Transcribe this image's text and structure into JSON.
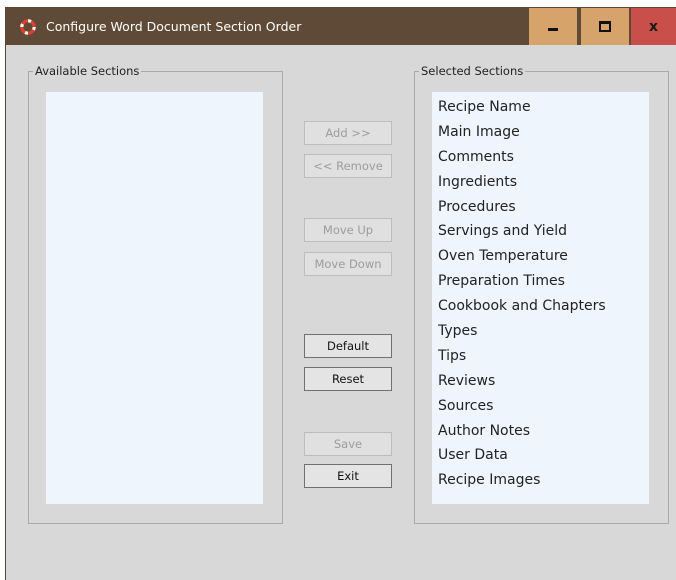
{
  "window": {
    "title": "Configure Word Document Section Order",
    "minimize_icon": "minimize-icon",
    "maximize_icon": "maximize-icon",
    "close_glyph": "x"
  },
  "available": {
    "legend": "Available Sections",
    "items": []
  },
  "selected": {
    "legend": "Selected Sections",
    "items": [
      "Recipe Name",
      "Main Image",
      "Comments",
      "Ingredients",
      "Procedures",
      "Servings and Yield",
      "Oven Temperature",
      "Preparation Times",
      "Cookbook and Chapters",
      "Types",
      "Tips",
      "Reviews",
      "Sources",
      "Author Notes",
      "User Data",
      "Recipe Images"
    ]
  },
  "buttons": {
    "add": "Add >>",
    "remove": "<< Remove",
    "move_up": "Move Up",
    "move_down": "Move Down",
    "default": "Default",
    "reset": "Reset",
    "save": "Save",
    "exit": "Exit"
  },
  "colors": {
    "titlebar": "#5e4a36",
    "window_bg": "#d8d8d8",
    "list_bg": "#eef5fd",
    "close_button": "#c9504a",
    "caption_buttons": "#d6a46a"
  }
}
